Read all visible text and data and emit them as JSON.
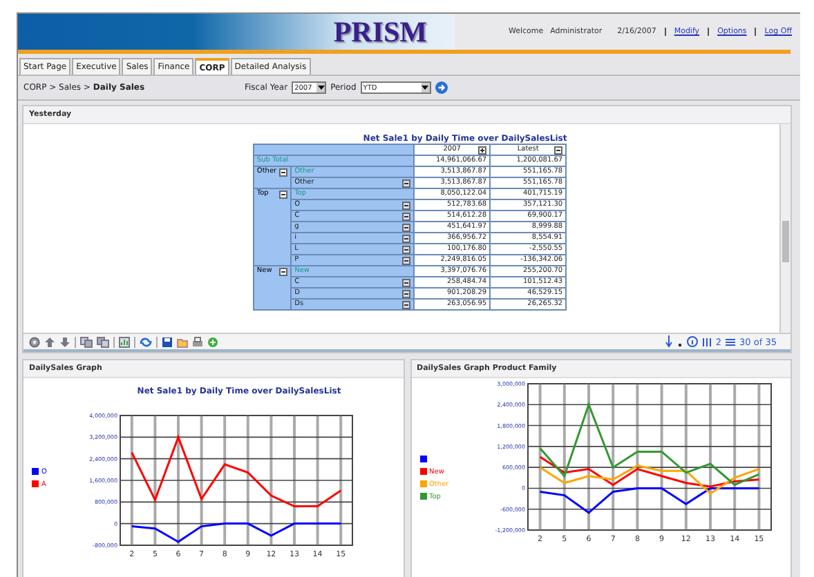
{
  "header": {
    "logo": "PRISM",
    "welcome": "Welcome",
    "user": "Administrator",
    "date": "2/16/2007",
    "links": [
      "Modify",
      "Options",
      "Log Off"
    ]
  },
  "tabs": [
    {
      "label": "Start Page",
      "selected": false
    },
    {
      "label": "Executive",
      "selected": false
    },
    {
      "label": "Sales",
      "selected": false
    },
    {
      "label": "Finance",
      "selected": false
    },
    {
      "label": "CORP",
      "selected": true
    },
    {
      "label": "Detailed Analysis",
      "selected": false
    }
  ],
  "breadcrumb": "CORP > Sales > **Daily Sales**",
  "filters": {
    "fiscal_year_label": "Fiscal Year",
    "fiscal_year": "2007",
    "period_label": "Period",
    "period": "YTD"
  },
  "top_panel": {
    "title": "Yesterday",
    "pivot": {
      "title": "Net Sale1 by Daily Time over DailySalesList",
      "columns": [
        "2007",
        "Latest"
      ],
      "subtotal": {
        "label": "Sub Total",
        "values": [
          "14,961,066.67",
          "1,200,081.67"
        ]
      },
      "groups": [
        {
          "label": "Other",
          "children": [
            {
              "label": "Other",
              "kind": "total",
              "values": [
                "3,513,867.87",
                "551,165.78"
              ]
            },
            {
              "label": "Other",
              "kind": "item",
              "values": [
                "3,513,867.87",
                "551,165.78"
              ]
            }
          ]
        },
        {
          "label": "Top",
          "children": [
            {
              "label": "Top",
              "kind": "total",
              "values": [
                "8,050,122.04",
                "401,715.19"
              ]
            },
            {
              "label": "O",
              "kind": "item",
              "values": [
                "512,783.68",
                "357,121.30"
              ]
            },
            {
              "label": "C",
              "kind": "item",
              "values": [
                "514,612.28",
                "69,900.17"
              ]
            },
            {
              "label": "g",
              "kind": "item",
              "values": [
                "451,641.97",
                "8,999.88"
              ]
            },
            {
              "label": "i",
              "kind": "item",
              "values": [
                "366,956.72",
                "8,554.91"
              ]
            },
            {
              "label": "L",
              "kind": "item",
              "values": [
                "100,176.80",
                "-2,550.55"
              ]
            },
            {
              "label": "P",
              "kind": "item",
              "values": [
                "2,249,816.05",
                "-136,342.06"
              ]
            }
          ]
        },
        {
          "label": "New",
          "children": [
            {
              "label": "New",
              "kind": "total",
              "values": [
                "3,397,076.76",
                "255,200.70"
              ]
            },
            {
              "label": "C",
              "kind": "item",
              "values": [
                "258,484.74",
                "101,512.43"
              ]
            },
            {
              "label": "D",
              "kind": "item",
              "values": [
                "901,208.29",
                "46,529.15"
              ]
            },
            {
              "label": "Ds",
              "kind": "item",
              "values": [
                "263,056.95",
                "26,265.32"
              ]
            }
          ]
        }
      ]
    },
    "toolbar": {
      "page": "2",
      "rows": "30 of 35"
    }
  },
  "bottom_panels": [
    {
      "title": "DailySales Graph",
      "chart_data": {
        "type": "line",
        "grid": true,
        "title": "Net Sale1 by Daily Time over DailySalesList",
        "categories": [
          "2",
          "5",
          "6",
          "7",
          "8",
          "9",
          "12",
          "13",
          "14",
          "15"
        ],
        "ylim": [
          -800000,
          4000000
        ],
        "yticks": [
          {
            "value": -800000,
            "label": "-800,000"
          },
          {
            "value": 0,
            "label": "0"
          },
          {
            "value": 800000,
            "label": "800,000"
          },
          {
            "value": 1600000,
            "label": "1,600,000"
          },
          {
            "value": 2400000,
            "label": "2,400,000"
          },
          {
            "value": 3200000,
            "label": "3,200,000"
          },
          {
            "value": 4000000,
            "label": "4,000,000"
          }
        ],
        "series": [
          {
            "name": "O",
            "color": "#0000ff",
            "values": [
              -100000,
              -180000,
              -670000,
              -100000,
              0,
              0,
              -440000,
              0,
              0,
              0
            ]
          },
          {
            "name": "A",
            "color": "#ff0000",
            "values": [
              2630000,
              880000,
              3200000,
              910000,
              2190000,
              1890000,
              1040000,
              640000,
              640000,
              1220000
            ]
          }
        ]
      }
    },
    {
      "title": "DailySales Graph Product Family",
      "chart_data": {
        "type": "line",
        "grid": true,
        "categories": [
          "2",
          "5",
          "6",
          "7",
          "8",
          "9",
          "12",
          "13",
          "14",
          "15"
        ],
        "ylim": [
          -1200000,
          3000000
        ],
        "yticks": [
          {
            "value": -1200000,
            "label": "-1,200,000"
          },
          {
            "value": -600000,
            "label": "-600,000"
          },
          {
            "value": 0,
            "label": "0"
          },
          {
            "value": 600000,
            "label": "600,000"
          },
          {
            "value": 1200000,
            "label": "1,200,000"
          },
          {
            "value": 1800000,
            "label": "1,800,000"
          },
          {
            "value": 2400000,
            "label": "2,400,000"
          },
          {
            "value": 3000000,
            "label": "3,000,000"
          }
        ],
        "series": [
          {
            "color": "#0000ff",
            "values": [
              -100000,
              -200000,
              -700000,
              -100000,
              0,
              0,
              -450000,
              0,
              0,
              0
            ]
          },
          {
            "name": "New",
            "color": "#ff0000",
            "values": [
              900000,
              450000,
              550000,
              100000,
              550000,
              350000,
              150000,
              50000,
              200000,
              250000
            ]
          },
          {
            "name": "Other",
            "color": "#ffa500",
            "values": [
              600000,
              150000,
              350000,
              250000,
              650000,
              500000,
              500000,
              -150000,
              300000,
              550000
            ]
          },
          {
            "name": "Top",
            "color": "#339933",
            "values": [
              1150000,
              350000,
              2400000,
              600000,
              1050000,
              1050000,
              450000,
              700000,
              100000,
              400000
            ]
          }
        ]
      }
    }
  ]
}
